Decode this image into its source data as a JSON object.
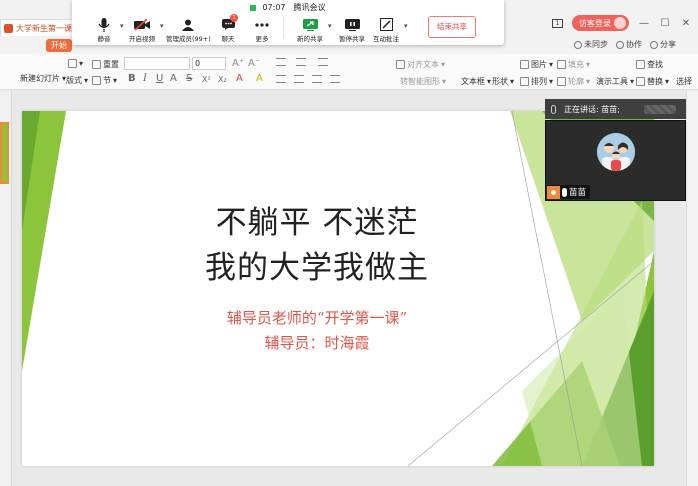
{
  "titlebar": {
    "doc_tab": "大学新生第一课.pp",
    "guest_login": "访客登录"
  },
  "menu": {
    "start": "开始",
    "sync": "未同步",
    "collab": "协作",
    "share": "分享"
  },
  "ribbon": {
    "new_slide": "新建幻灯片",
    "layout": "版式",
    "section": "节",
    "reset": "重置",
    "font_size": "0",
    "align_text": "对齐文本",
    "smart_graphic": "转智能图形",
    "textbox": "文本框",
    "shape": "形状",
    "picture": "图片",
    "arrange": "排列",
    "fill": "填充",
    "outline": "轮廓",
    "find": "查找",
    "present_tools": "演示工具",
    "replace": "替换",
    "select": "选择"
  },
  "meeting": {
    "time": "07:07",
    "app_name": "腾讯会议",
    "mute": "静音",
    "start_video": "开启视频",
    "manage_members": "管理成员(99+)",
    "chat": "聊天",
    "chat_badge": "1",
    "more": "更多",
    "new_share": "新的共享",
    "pause_share": "暂停共享",
    "annotate": "互动批注",
    "end_share": "结束共享"
  },
  "slide": {
    "title_line1": "不躺平  不迷茫",
    "title_line2": "我的大学我做主",
    "sub_line1": "辅导员老师的“开学第一课”",
    "sub_line2": "辅导员：时海霞"
  },
  "speaker": {
    "speaking_label": "正在讲话:  苗苗;",
    "name": "苗苗"
  },
  "colors": {
    "accent_green": "#8cc43b",
    "dark_green": "#5a9e2b",
    "end_share_red": "#e8493e",
    "wps_orange": "#f16a3b"
  }
}
